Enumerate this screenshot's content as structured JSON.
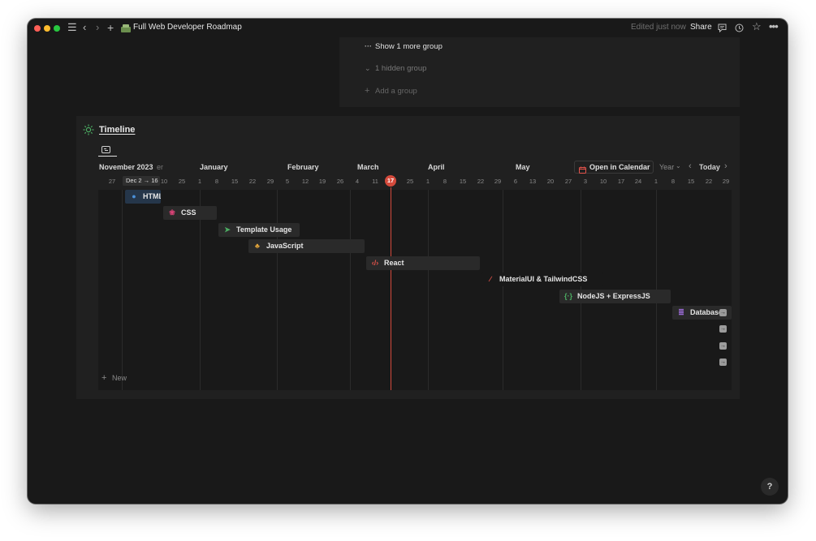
{
  "window": {
    "page_title": "Full Web Developer Roadmap",
    "edited_text": "Edited just now",
    "share_label": "Share"
  },
  "groups_panel": {
    "show_more": "Show 1 more group",
    "hidden_group": "1 hidden group",
    "add_group": "Add a group"
  },
  "timeline": {
    "title": "Timeline",
    "open_calendar_label": "Open in Calendar",
    "scale_label": "Year",
    "today_label": "Today",
    "new_label": "New",
    "today_marker": "17",
    "first_month": "November 2023",
    "date_range_label": "Dec 2 → 16",
    "truncated_month": "er",
    "months": [
      "January",
      "February",
      "March",
      "April",
      "May"
    ],
    "days": [
      "27",
      "10",
      "25",
      "1",
      "8",
      "15",
      "22",
      "29",
      "5",
      "12",
      "19",
      "26",
      "4",
      "11",
      "25",
      "1",
      "8",
      "15",
      "22",
      "29",
      "6",
      "13",
      "20",
      "27",
      "3",
      "10",
      "17",
      "24",
      "1",
      "8",
      "15",
      "22",
      "29"
    ],
    "items": [
      {
        "label": "HTML",
        "icon": "globe-icon",
        "color": "#4a90d9"
      },
      {
        "label": "CSS",
        "icon": "palette-icon",
        "color": "#e0447a"
      },
      {
        "label": "Template Usage",
        "icon": "cursor-icon",
        "color": "#4cae63"
      },
      {
        "label": "JavaScript",
        "icon": "people-icon",
        "color": "#e3a53a"
      },
      {
        "label": "React",
        "icon": "code-icon",
        "color": "#e5534b"
      },
      {
        "label": "MaterialUI & TailwindCSS",
        "icon": "brush-icon",
        "color": "#e5534b"
      },
      {
        "label": "NodeJS + ExpressJS",
        "icon": "braces-icon",
        "color": "#4cae63"
      },
      {
        "label": "Database",
        "icon": "database-icon",
        "color": "#9b6bd6"
      }
    ]
  },
  "colors": {
    "background": "#191919",
    "panel": "#202020",
    "bar": "#2a2a2a",
    "today_red": "#d44a3c",
    "text": "#d4d4d4",
    "muted": "#8a8a8a"
  }
}
